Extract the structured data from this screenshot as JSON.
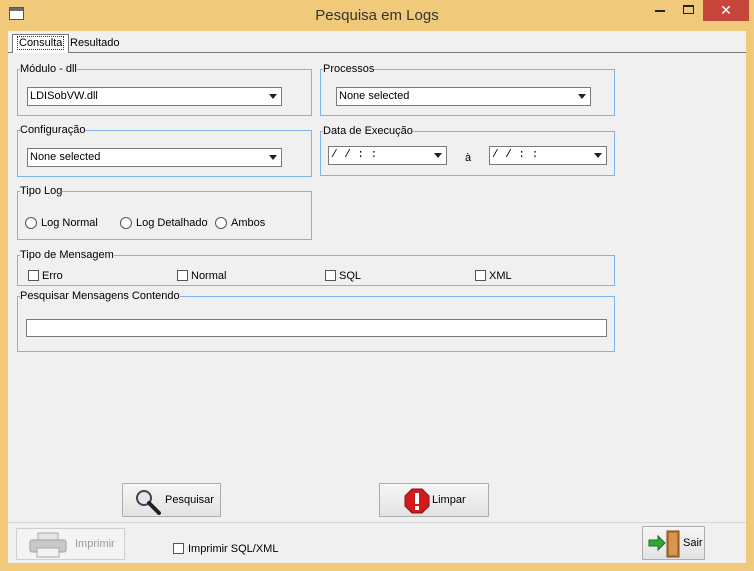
{
  "window": {
    "title": "Pesquisa em Logs",
    "close_glyph": "✕"
  },
  "tabs": [
    {
      "label": "Consulta",
      "active": true
    },
    {
      "label": "Resultado",
      "active": false
    }
  ],
  "form": {
    "modulo": {
      "legend": "Módulo - dll",
      "value": "LDISobVW.dll"
    },
    "processos": {
      "legend": "Processos",
      "value": "None selected"
    },
    "configuracao": {
      "legend": "Configuração",
      "value": "None selected"
    },
    "data_execucao": {
      "legend": "Data de Execução",
      "from_value": "/ /      : :",
      "separator": "à",
      "to_value": "/ /      : :"
    },
    "tipo_log": {
      "legend": "Tipo Log",
      "options": [
        "Log Normal",
        "Log Detalhado",
        "Ambos"
      ]
    },
    "tipo_mensagem": {
      "legend": "Tipo de Mensagem",
      "options": [
        "Erro",
        "Normal",
        "SQL",
        "XML"
      ]
    },
    "pesquisar_mensagens": {
      "legend": "Pesquisar Mensagens Contendo",
      "value": ""
    }
  },
  "buttons": {
    "pesquisar": "Pesquisar",
    "limpar": "Limpar",
    "imprimir": "Imprimir",
    "sair": "Sair"
  },
  "imprimir_sql_xml": "Imprimir SQL/XML",
  "icons": {
    "app": "app-window-icon",
    "pesquisar": "magnifier-icon",
    "limpar": "stop-exclamation-icon",
    "imprimir": "printer-icon",
    "sair": "exit-door-icon"
  },
  "colors": {
    "frame": "#f1c97a",
    "group_border": "#7eb4ea",
    "close_button": "#c7463c",
    "limpar_icon": "#d11a1a"
  }
}
